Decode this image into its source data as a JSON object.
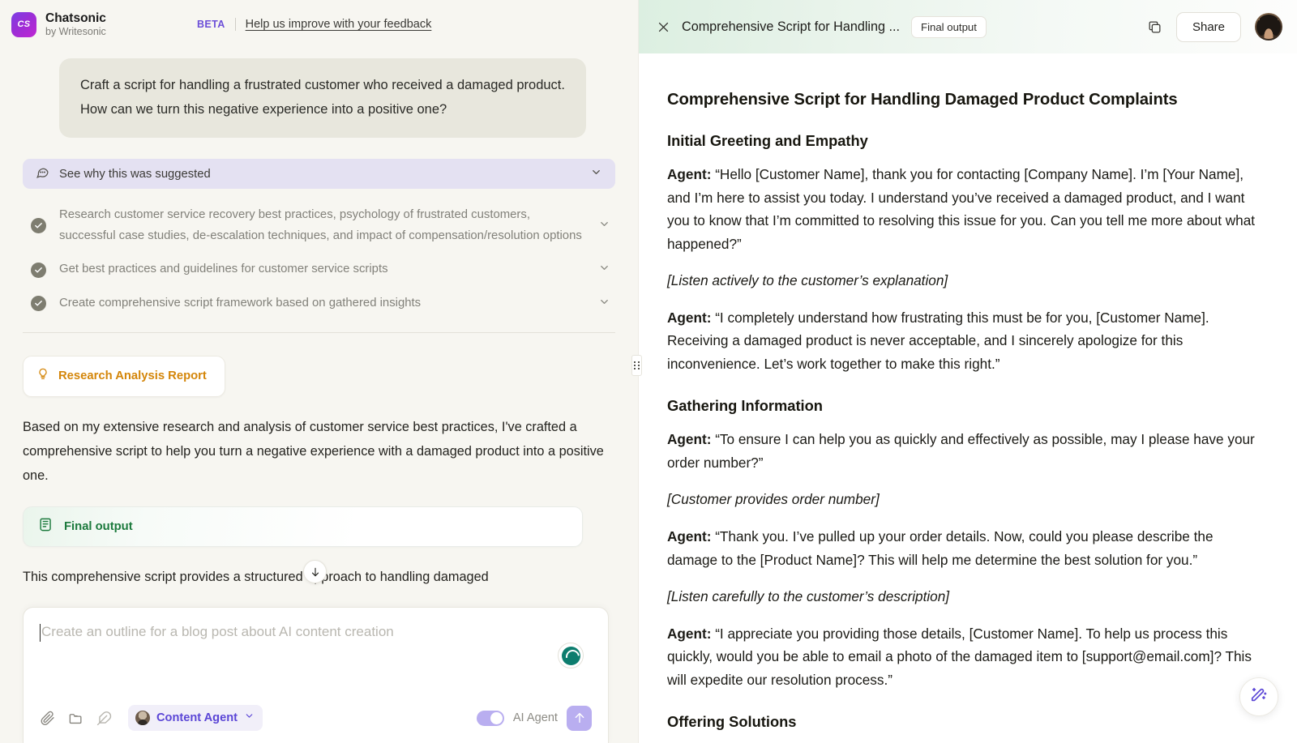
{
  "brand": {
    "logo_text": "CS",
    "name": "Chatsonic",
    "subtitle": "by Writesonic",
    "beta_tag": "BETA",
    "feedback_link": "Help us improve with your feedback"
  },
  "conversation": {
    "user_prompt": "Craft a script for handling a frustrated customer who received a damaged product. How can we turn this negative experience into a positive one?",
    "suggestion_banner": "See why this was suggested",
    "tasks": [
      {
        "label": "Research customer service recovery best practices, psychology of frustrated customers, successful case studies, de-escalation techniques, and impact of compensation/resolution options",
        "status": "complete"
      },
      {
        "label": "Get best practices and guidelines for customer service scripts",
        "status": "complete"
      },
      {
        "label": "Create comprehensive script framework based on gathered insights",
        "status": "complete"
      }
    ],
    "report_chip": "Research Analysis Report",
    "assistant_paragraph": "Based on my extensive research and analysis of customer service best practices, I've crafted a comprehensive script to help you turn a negative experience with a damaged product into a positive one.",
    "final_output_card": "Final output",
    "trailing_paragraph": "This comprehensive script provides a structured approach to handling damaged"
  },
  "composer": {
    "placeholder": "Create an outline for a blog post about AI content creation",
    "value": "",
    "agent_chip": "Content Agent",
    "toggle_label": "AI Agent",
    "toggle_on": true,
    "icons": [
      "paperclip-icon",
      "folder-icon",
      "feather-icon"
    ]
  },
  "document_panel": {
    "header_title": "Comprehensive Script for Handling ...",
    "header_badge": "Final output",
    "share_label": "Share",
    "title": "Comprehensive Script for Handling Damaged Product Complaints",
    "sections": [
      {
        "heading": "Initial Greeting and Empathy",
        "blocks": [
          {
            "type": "dialog",
            "speaker": "Agent:",
            "text": " “Hello [Customer Name], thank you for contacting [Company Name]. I’m [Your Name], and I’m here to assist you today. I understand you’ve received a damaged product, and I want you to know that I’m committed to resolving this issue for you. Can you tell me more about what happened?”"
          },
          {
            "type": "stage",
            "text": "[Listen actively to the customer’s explanation]"
          },
          {
            "type": "dialog",
            "speaker": "Agent:",
            "text": " “I completely understand how frustrating this must be for you, [Customer Name]. Receiving a damaged product is never acceptable, and I sincerely apologize for this inconvenience. Let’s work together to make this right.”"
          }
        ]
      },
      {
        "heading": "Gathering Information",
        "blocks": [
          {
            "type": "dialog",
            "speaker": "Agent:",
            "text": " “To ensure I can help you as quickly and effectively as possible, may I please have your order number?”"
          },
          {
            "type": "stage",
            "text": "[Customer provides order number]"
          },
          {
            "type": "dialog",
            "speaker": "Agent:",
            "text": " “Thank you. I’ve pulled up your order details. Now, could you please describe the damage to the [Product Name]? This will help me determine the best solution for you.”"
          },
          {
            "type": "stage",
            "text": "[Listen carefully to the customer’s description]"
          },
          {
            "type": "dialog",
            "speaker": "Agent:",
            "text": " “I appreciate you providing those details, [Customer Name]. To help us process this quickly, would you be able to email a photo of the damaged item to [support@email.com]? This will expedite our resolution process.”"
          }
        ]
      },
      {
        "heading": "Offering Solutions",
        "blocks": []
      }
    ]
  },
  "colors": {
    "accent_purple": "#5b46d6",
    "accent_green": "#1c7a3d",
    "accent_orange": "#d4860a",
    "spinner_teal": "#0d7d6e",
    "left_bg": "#f7f6f1",
    "bubble_bg": "#e8e7dd",
    "banner_bg": "#e4e1f2"
  }
}
